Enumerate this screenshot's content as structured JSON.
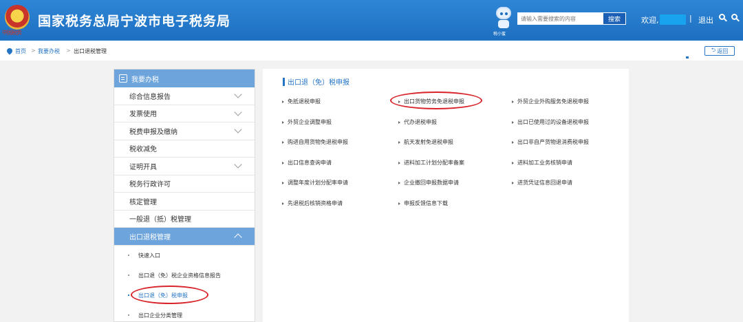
{
  "header": {
    "emblem_text": "中国税务",
    "title": "国家税务总局宁波市电子税务局",
    "robot_label": "税小蜜",
    "search_placeholder": "请输入需要搜索的内容",
    "search_button": "搜索",
    "welcome": "欢迎,",
    "separator": "|",
    "logout": "退出"
  },
  "breadcrumb": {
    "items": [
      "首页",
      "我要办税",
      "出口退税管理"
    ],
    "separator": ">",
    "back_label": "返回"
  },
  "sidebar": {
    "heading": "我要办税",
    "items": [
      {
        "label": "综合信息报告",
        "expandable": true
      },
      {
        "label": "发票使用",
        "expandable": true
      },
      {
        "label": "税费申报及缴纳",
        "expandable": true
      },
      {
        "label": "税收减免",
        "expandable": false
      },
      {
        "label": "证明开具",
        "expandable": true
      },
      {
        "label": "税务行政许可",
        "expandable": false
      },
      {
        "label": "核定管理",
        "expandable": false
      },
      {
        "label": "一般退（抵）税管理",
        "expandable": false
      },
      {
        "label": "出口退税管理",
        "expandable": true,
        "expanded": true
      }
    ],
    "sub_items": [
      "快速入口",
      "出口退（免）税企业资格信息报告",
      "出口退（免）税申报",
      "出口企业分类管理"
    ]
  },
  "panel": {
    "title": "出口退（免）税申报",
    "links": [
      [
        "免抵退税申报",
        "出口货物劳务免退税申报",
        "外贸企业外购服务免退税申报"
      ],
      [
        "外贸企业调整申报",
        "代办退税申报",
        "出口已使用过的设备退税申报"
      ],
      [
        "购进自用货物免退税申报",
        "航天发射免退税申报",
        "出口非自产货物退消费税申报"
      ],
      [
        "出口信息查询申请",
        "进料加工计划分配率备案",
        "进料加工业务核销申请"
      ],
      [
        "调整年度计划分配率申请",
        "企业撤回申报数据申请",
        "进货凭证信息回退申请"
      ],
      [
        "先退税后核销资格申请",
        "申报反馈信息下载",
        ""
      ]
    ]
  },
  "colors": {
    "header_blue": "#1d6fc0",
    "accent": "#2474c5",
    "menu_active": "#6da4dc",
    "highlight_red": "#d8232a"
  }
}
